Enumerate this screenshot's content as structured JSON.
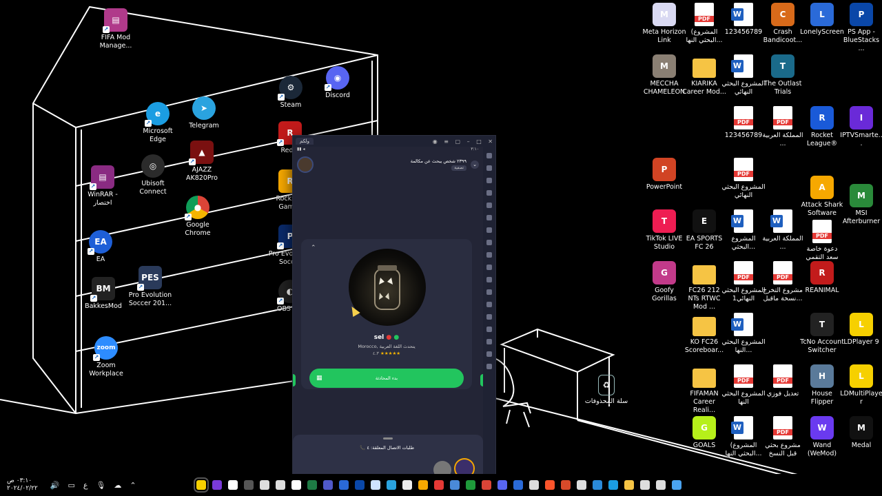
{
  "desktop_icons_left": [
    {
      "label": "FIFA Mod Manage...",
      "icon": "winrar-icon",
      "color": "#b03a8a"
    },
    {
      "label": "Steam",
      "icon": "steam-icon",
      "color": "#1b2838"
    },
    {
      "label": "Discord",
      "icon": "discord-icon",
      "color": "#5865f2"
    },
    {
      "label": "Microsoft Edge",
      "icon": "edge-icon",
      "color": "#1b9de2"
    },
    {
      "label": "Telegram",
      "icon": "telegram-icon",
      "color": "#2aa3df"
    },
    {
      "label": "Red...",
      "icon": "red-app-icon",
      "color": "#c21b1b"
    },
    {
      "label": "WinRAR - اختصار",
      "icon": "winrar-icon",
      "color": "#8a2b82"
    },
    {
      "label": "Ubisoft Connect",
      "icon": "ubisoft-icon",
      "color": "#2b2b2b"
    },
    {
      "label": "AJAZZ AK820Pro",
      "icon": "ajazz-icon",
      "color": "#7a1010"
    },
    {
      "label": "Rockstar Games",
      "icon": "rockstar-icon",
      "color": "#f6a800"
    },
    {
      "label": "Google Chrome",
      "icon": "chrome-icon",
      "color": "#db4437"
    },
    {
      "label": "EA",
      "icon": "ea-icon",
      "color": "#1e5fd7"
    },
    {
      "label": "Pro Evolution Soccer",
      "icon": "pes-icon",
      "color": "#0a2a6a"
    },
    {
      "label": "BakkesMod",
      "icon": "bakkesmod-icon",
      "color": "#222"
    },
    {
      "label": "Pro Evolution Soccer 201...",
      "icon": "pes-icon",
      "color": "#2a3a5a"
    },
    {
      "label": "OBS S...",
      "icon": "obs-icon",
      "color": "#222"
    },
    {
      "label": "Zoom Workplace",
      "icon": "zoom-icon",
      "color": "#2d8cff"
    }
  ],
  "desktop_icons_right": [
    {
      "label": "Meta Horizon Link",
      "icon": "meta-icon",
      "type": "app",
      "color": "#d9d9f2"
    },
    {
      "label": "المشروع) البحثي النها...",
      "icon": "pdf-icon",
      "type": "pdf"
    },
    {
      "label": "123456789",
      "icon": "word-icon",
      "type": "word"
    },
    {
      "label": "Crash Bandicoot...",
      "icon": "crash-icon",
      "type": "app",
      "color": "#d86a1a"
    },
    {
      "label": "LonelyScreen",
      "icon": "lonelyscreen-icon",
      "type": "app",
      "color": "#2a6ad8"
    },
    {
      "label": "PS App - BlueStacks ...",
      "icon": "ps-icon",
      "type": "app",
      "color": "#0a47a8"
    },
    {
      "label": "MECCHA CHAMELEON",
      "icon": "meccha-icon",
      "type": "app",
      "color": "#8a7f73"
    },
    {
      "label": "KIARIKA Career Mod...",
      "icon": "folder-icon",
      "type": "folder"
    },
    {
      "label": "المشروع البحثي النهائي",
      "icon": "word-icon",
      "type": "word"
    },
    {
      "label": "The Outlast Trials",
      "icon": "outlast-icon",
      "type": "app",
      "color": "#1a6a8a"
    },
    {
      "label": "123456789",
      "icon": "pdf-icon",
      "type": "pdf"
    },
    {
      "label": "المملكة العربية ...",
      "icon": "pdf-icon",
      "type": "pdf"
    },
    {
      "label": "Rocket League®",
      "icon": "rocket-league-icon",
      "type": "app",
      "color": "#1a5ad8"
    },
    {
      "label": "IPTVSmarte...",
      "icon": "iptv-icon",
      "type": "app",
      "color": "#6a2ad8"
    },
    {
      "label": "PowerPoint",
      "icon": "powerpoint-icon",
      "type": "app",
      "color": "#d14424"
    },
    {
      "label": "المشروع البحثي النهائي",
      "icon": "pdf-icon",
      "type": "pdf"
    },
    {
      "label": "Attack Shark Software",
      "icon": "attack-shark-icon",
      "type": "app",
      "color": "#f6a800"
    },
    {
      "label": "MSI Afterburner",
      "icon": "msi-icon",
      "type": "app",
      "color": "#2a8a3a"
    },
    {
      "label": "TikTok LIVE Studio",
      "icon": "tiktok-icon",
      "type": "app",
      "color": "#ee1d52"
    },
    {
      "label": "EA SPORTS FC 26",
      "icon": "fc26-icon",
      "type": "app",
      "color": "#111"
    },
    {
      "label": "المشروع البحثي...",
      "icon": "word-icon",
      "type": "word"
    },
    {
      "label": "المملكة العربية ...",
      "icon": "word-icon",
      "type": "word"
    },
    {
      "label": "دعوة خاصة سعد التقمي",
      "icon": "pdf-icon",
      "type": "pdf"
    },
    {
      "label": "Goofy Gorillas",
      "icon": "goofy-icon",
      "type": "app",
      "color": "#c23a8a"
    },
    {
      "label": "FC26 212 NTs RTWC Mod ...",
      "icon": "folder-icon",
      "type": "folder"
    },
    {
      "label": "المشروع البحثي النهائي1",
      "icon": "pdf-icon",
      "type": "pdf"
    },
    {
      "label": "مشروع التخرج نسخة ماقبل...",
      "icon": "pdf-icon",
      "type": "pdf"
    },
    {
      "label": "REANIMAL",
      "icon": "reanimal-icon",
      "type": "app",
      "color": "#c21b1b"
    },
    {
      "label": "KO FC26 Scoreboar...",
      "icon": "folder-icon",
      "type": "folder"
    },
    {
      "label": "المشروع البحثي النها...",
      "icon": "word-icon",
      "type": "word"
    },
    {
      "label": "TcNo Account Switcher",
      "icon": "tcno-icon",
      "type": "app",
      "color": "#222"
    },
    {
      "label": "LDPlayer 9",
      "icon": "ldplayer-icon",
      "type": "app",
      "color": "#f6d000"
    },
    {
      "label": "FIFAMAN Career Reali...",
      "icon": "folder-icon",
      "type": "folder"
    },
    {
      "label": "المشروع البحثي النها",
      "icon": "pdf-icon",
      "type": "pdf"
    },
    {
      "label": "تعديل فوزي",
      "icon": "pdf-icon",
      "type": "pdf"
    },
    {
      "label": "House Flipper",
      "icon": "house-flipper-icon",
      "type": "app",
      "color": "#5a7a9a"
    },
    {
      "label": "LDMultiPlayer",
      "icon": "ldmultiplayer-icon",
      "type": "app",
      "color": "#f6d000"
    },
    {
      "label": "GOALS",
      "icon": "goals-icon",
      "type": "app",
      "color": "#b6f01a"
    },
    {
      "label": "المشروع) البحثي النها...",
      "icon": "word-icon",
      "type": "word"
    },
    {
      "label": "مشروع بحثي قبل النسخ",
      "icon": "pdf-icon",
      "type": "pdf"
    },
    {
      "label": "Wand (WeMod)",
      "icon": "wand-icon",
      "type": "app",
      "color": "#6a3af0"
    },
    {
      "label": "Medal",
      "icon": "medal-icon",
      "type": "app",
      "color": "#111"
    }
  ],
  "recycle_bin": {
    "label": "سلة المحذوفات",
    "icon": "recycle-bin-icon"
  },
  "app_window": {
    "tab_title": "ولكم",
    "status_time": "٣:١٠",
    "header_text": "٢٣٩٩ شخص يبحث عن مكالمة",
    "header_badge": "تصفية",
    "profile": {
      "name": "sel",
      "location": "Morocco, يتحدث اللغة العربية",
      "rating_stars": "★★★★★",
      "rating_value": "٤.٣"
    },
    "call_button": "بدء المحادثة",
    "bottom_text": "طلبات الاتصال المعلقة: ٤"
  },
  "taskbar": {
    "time": "٠٣:١٠ ص",
    "date": "٢٠٢٤/٠٢/٢٢",
    "tray": [
      "volume-icon",
      "display-icon",
      "ع",
      "mic-icon",
      "network-icon",
      "chevron-up-icon"
    ],
    "apps": [
      {
        "icon": "ldplayer-icon",
        "color": "#f6d000",
        "active": true
      },
      {
        "icon": "app-icon",
        "color": "#7a3ad8"
      },
      {
        "icon": "file-icon",
        "color": "#ffffff"
      },
      {
        "icon": "msi-icon",
        "color": "#555555"
      },
      {
        "icon": "gear-icon",
        "color": "#dddddd"
      },
      {
        "icon": "plane-icon",
        "color": "#dddddd"
      },
      {
        "icon": "capcut-icon",
        "color": "#ffffff"
      },
      {
        "icon": "excel-icon",
        "color": "#1e7a44"
      },
      {
        "icon": "teams-icon",
        "color": "#5059c9"
      },
      {
        "icon": "gear-icon",
        "color": "#2a6ad8"
      },
      {
        "icon": "ps-icon",
        "color": "#0a47a8"
      },
      {
        "icon": "monitor-icon",
        "color": "#cfe2ff"
      },
      {
        "icon": "telegram-icon",
        "color": "#2aa3df"
      },
      {
        "icon": "github-icon",
        "color": "#eeeeee"
      },
      {
        "icon": "sword-icon",
        "color": "#f6a800"
      },
      {
        "icon": "opera-icon",
        "color": "#e53935"
      },
      {
        "icon": "photos-icon",
        "color": "#4a8ad8"
      },
      {
        "icon": "xbox-icon",
        "color": "#1e9a3a"
      },
      {
        "icon": "chrome-icon",
        "color": "#db4437"
      },
      {
        "icon": "discord-icon",
        "color": "#5865f2"
      },
      {
        "icon": "rocket-icon",
        "color": "#2a6ad8"
      },
      {
        "icon": "steam-icon",
        "color": "#dddddd"
      },
      {
        "icon": "brave-icon",
        "color": "#fb542b"
      },
      {
        "icon": "flag-icon",
        "color": "#d84a2a"
      },
      {
        "icon": "cube-icon",
        "color": "#dddddd"
      },
      {
        "icon": "store-icon",
        "color": "#2a8ad8"
      },
      {
        "icon": "edge-icon",
        "color": "#1b9de2"
      },
      {
        "icon": "explorer-icon",
        "color": "#f6c444"
      },
      {
        "icon": "taskview-icon",
        "color": "#dddddd"
      },
      {
        "icon": "search-icon",
        "color": "#dddddd"
      },
      {
        "icon": "windows-icon",
        "color": "#4aa3f0"
      }
    ]
  }
}
